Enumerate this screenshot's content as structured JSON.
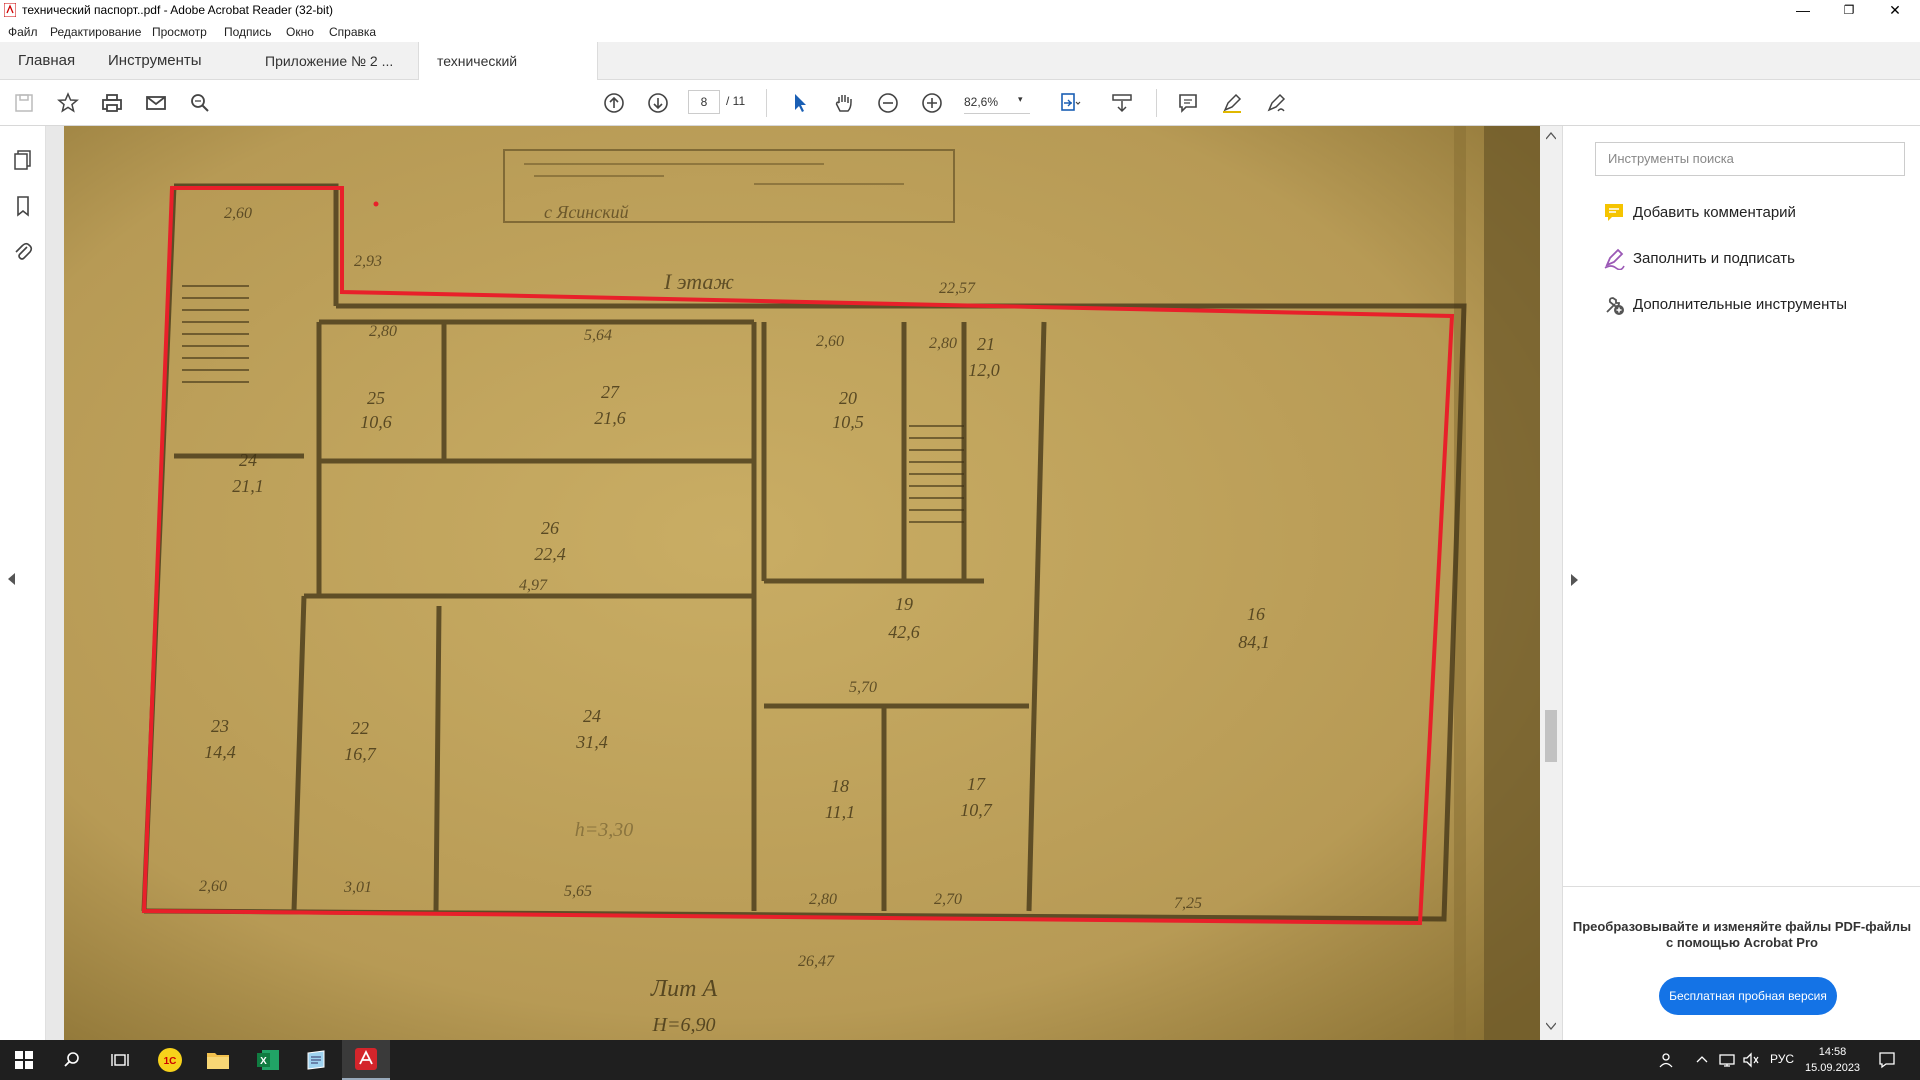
{
  "window": {
    "title": "технический паспорт..pdf - Adobe Acrobat Reader (32-bit)",
    "minimize": "—",
    "restore": "❐",
    "close": "✕"
  },
  "menu": [
    "Файл",
    "Редактирование",
    "Просмотр",
    "Подпись",
    "Окно",
    "Справка"
  ],
  "tabs": {
    "home": "Главная",
    "tools": "Инструменты",
    "doc1": "Приложение № 2 ...",
    "doc2": "технический паспо...",
    "close": "✕"
  },
  "toolbar": {
    "page_current": "8",
    "page_total": "/ 11",
    "zoom": "82,6%",
    "zoom_arrow": "▾"
  },
  "right_pane": {
    "search_placeholder": "Инструменты поиска",
    "tools": [
      {
        "label": "Добавить комментарий",
        "icon": "comment-icon",
        "color": "#f5c400"
      },
      {
        "label": "Заполнить и подписать",
        "icon": "sign-icon",
        "color": "#9b59b6"
      },
      {
        "label": "Дополнительные инструменты",
        "icon": "more-tools-icon",
        "color": "#555555"
      }
    ],
    "promo_text_1": "Преобразовывайте и изменяйте файлы PDF-файлы",
    "promo_text_2": "с помощью Acrobat Pro",
    "promo_button": "Бесплатная пробная версия"
  },
  "document": {
    "floor_label": "I этаж",
    "stamp_line": "с Ясинский",
    "dimensions": {
      "top_total": "22,57",
      "bottom_total": "26,47",
      "d1": "2,60",
      "d2": "2,93",
      "d3": "2,80",
      "d4": "5,64",
      "d5": "2,60",
      "d6": "2,80",
      "d7": "4,97",
      "d8": "5,70",
      "d9": "2,60",
      "d10": "3,01",
      "d11": "5,65",
      "d12": "2,80",
      "d13": "2,70",
      "d14": "7,25"
    },
    "rooms": [
      {
        "num": "25",
        "area": "10,6"
      },
      {
        "num": "27",
        "area": "21,6"
      },
      {
        "num": "20",
        "area": "10,5"
      },
      {
        "num": "21",
        "area": "12,0"
      },
      {
        "num": "24",
        "area": "21,1"
      },
      {
        "num": "26",
        "area": "22,4"
      },
      {
        "num": "19",
        "area": "42,6"
      },
      {
        "num": "16",
        "area": "84,1"
      },
      {
        "num": "23",
        "area": "14,4"
      },
      {
        "num": "22",
        "area": "16,7"
      },
      {
        "num": "24",
        "area": "31,4"
      },
      {
        "num": "18",
        "area": "11,1"
      },
      {
        "num": "17",
        "area": "10,7"
      }
    ],
    "height_note": "h=3,30",
    "lit": "Лит А",
    "lit_h": "H=6,90"
  },
  "taskbar": {
    "lang": "РУС",
    "time": "14:58",
    "date": "15.09.2023"
  },
  "colors": {
    "accent": "#1473e6",
    "outline": "#e8202a",
    "paper": "#b89a55"
  }
}
